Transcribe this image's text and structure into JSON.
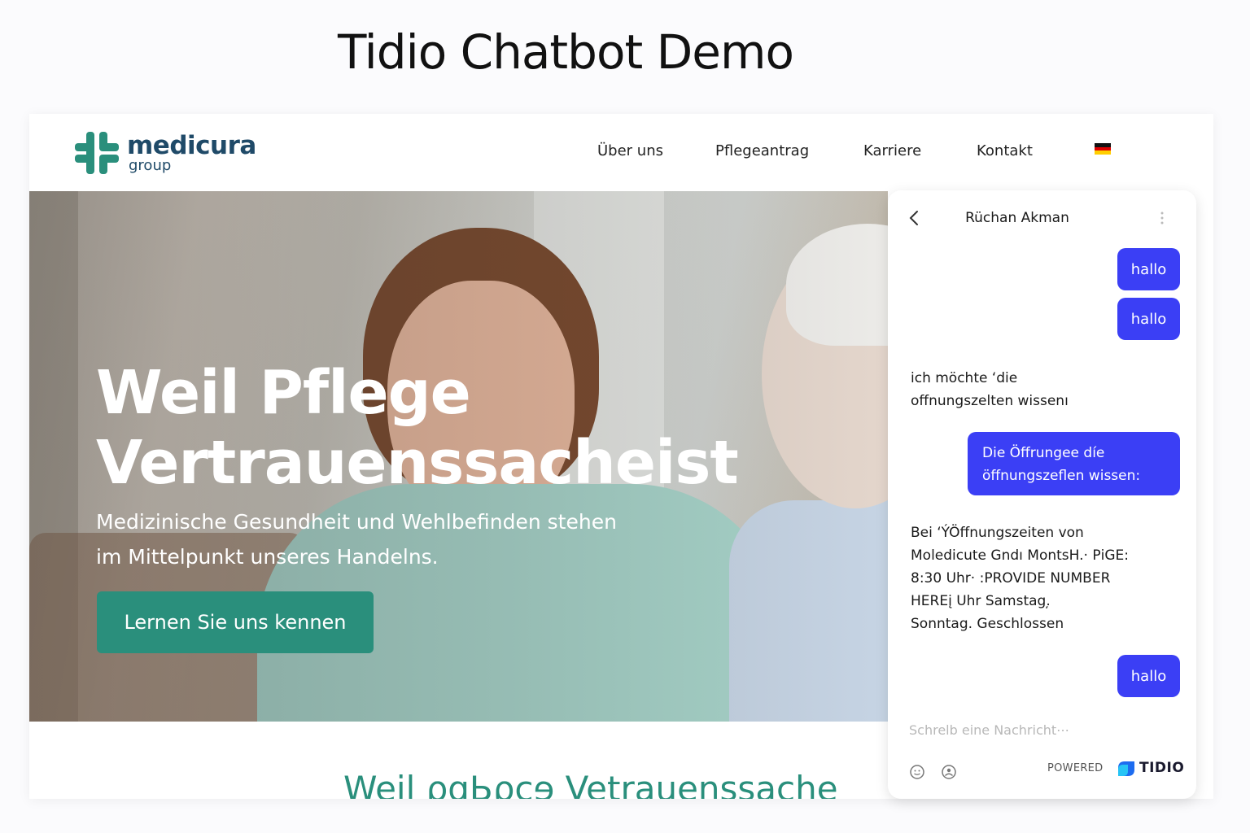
{
  "demo_title": "Tidio Chatbot Demo",
  "site": {
    "logo": {
      "name": "medicura",
      "sub": "group"
    },
    "nav": [
      "Über uns",
      "Pflegeantrag",
      "Karriere",
      "Kontakt"
    ],
    "language_flag": "de-flag-icon",
    "hero": {
      "headline_line1": "Weil Pflege",
      "headline_line2": "Vertrauenssacheist",
      "subtext_line1": "Medizinische Gesundheit und Wehlbefinden stehen",
      "subtext_line2": "im Mittelpunkt unseres Handelns.",
      "cta": "Lernen Sie uns kennen"
    },
    "section_title": "Weil ρɑЬϱϲɘ Vetrauenssache"
  },
  "chat": {
    "agent_name": "Rüchan Akman",
    "messages": [
      {
        "from": "user",
        "text": "hallo"
      },
      {
        "from": "user",
        "text": "hallo"
      },
      {
        "from": "bot",
        "lines": [
          "ich möchte ʻdie",
          "offnungszelten wissenı"
        ]
      },
      {
        "from": "user",
        "lines": [
          "Die Öffrungee díe",
          "öffnungszeflen wissen:"
        ]
      },
      {
        "from": "bot",
        "lines": [
          "Bei ʻÝÖffnungszeiten von",
          "Moledicute Gndı MontѕH.· ΡiGE:",
          "8:30 Uhr· :PROVIDE NUMBER",
          "HEREį Uhr Samstag.̦",
          "Sonntag. Geschlossen"
        ]
      },
      {
        "from": "user",
        "text": "hallo"
      }
    ],
    "input_placeholder": "Schrelb eine Nachricht⋯",
    "powered_label": "POWERED",
    "brand": "TIDIO"
  },
  "colors": {
    "brand_teal": "#2a8f7c",
    "brand_navy": "#1f4a68",
    "chat_bubble": "#3b3ff5"
  }
}
